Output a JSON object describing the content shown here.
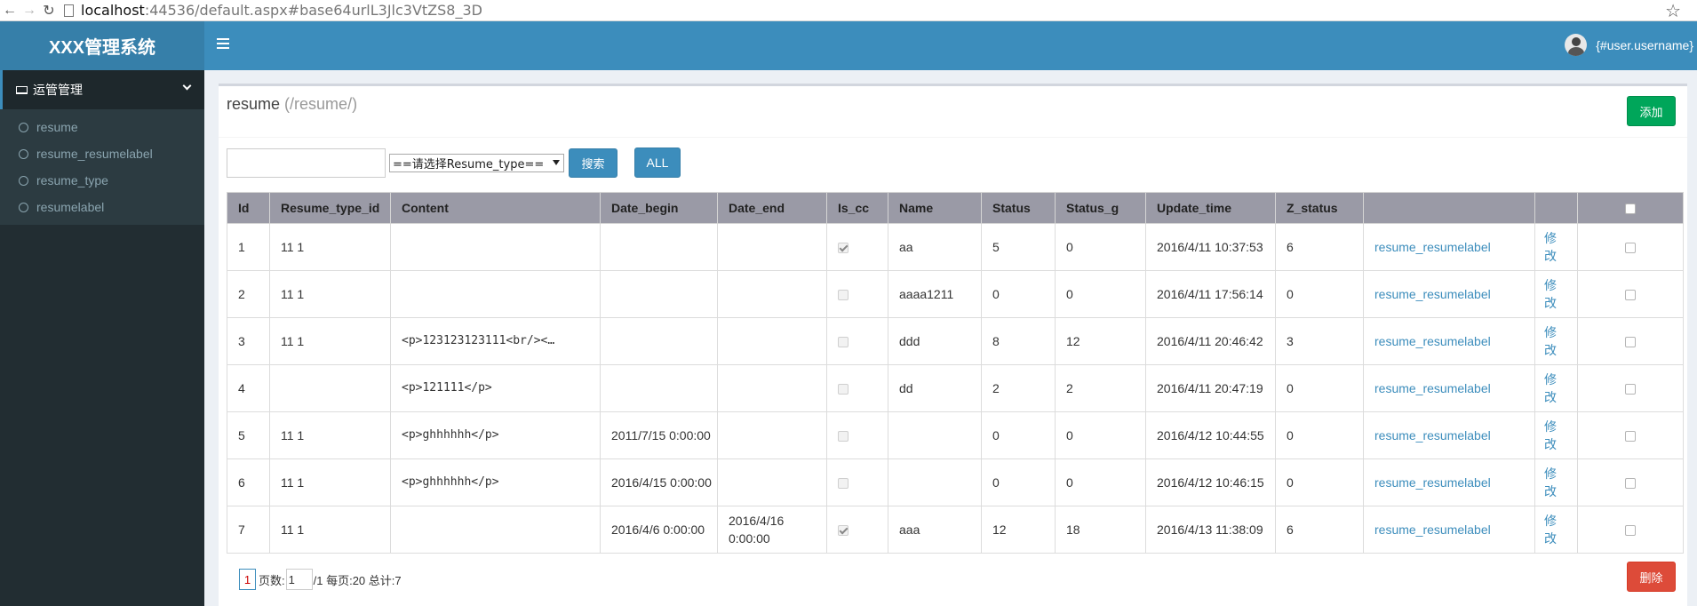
{
  "browser": {
    "url_host": "localhost",
    "url_path": ":44536/default.aspx#base64urlL3Jlc3VtZS8_3D"
  },
  "app": {
    "brand": "XXX管理系统",
    "username": "{#user.username}"
  },
  "sidebar": {
    "group_label": "运管管理",
    "items": [
      {
        "label": "resume"
      },
      {
        "label": "resume_resumelabel"
      },
      {
        "label": "resume_type"
      },
      {
        "label": "resumelabel"
      }
    ]
  },
  "page": {
    "title": "resume",
    "subtitle": "(/resume/)",
    "add_label": "添加",
    "search_placeholder": "",
    "select_label": "==请选择Resume_type==",
    "search_label": "搜索",
    "all_label": "ALL",
    "delete_label": "删除"
  },
  "table": {
    "columns": [
      "Id",
      "Resume_type_id",
      "Content",
      "Date_begin",
      "Date_end",
      "Is_cc",
      "Name",
      "Status",
      "Status_g",
      "Update_time",
      "Z_status",
      "",
      ""
    ],
    "rows": [
      {
        "id": "1",
        "type": "11 1",
        "content": "",
        "date_begin": "",
        "date_end": "",
        "is_cc": true,
        "name": "aa",
        "status": "5",
        "status_g": "0",
        "update_time": "2016/4/11 10:37:53",
        "z_status": "6",
        "link": "resume_resumelabel",
        "edit": "修改"
      },
      {
        "id": "2",
        "type": "11 1",
        "content": "",
        "date_begin": "",
        "date_end": "",
        "is_cc": false,
        "name": "aaaa1211",
        "status": "0",
        "status_g": "0",
        "update_time": "2016/4/11 17:56:14",
        "z_status": "0",
        "link": "resume_resumelabel",
        "edit": "修改"
      },
      {
        "id": "3",
        "type": "11 1",
        "content": "<p>123123123111<br/><…",
        "date_begin": "",
        "date_end": "",
        "is_cc": false,
        "name": "ddd",
        "status": "8",
        "status_g": "12",
        "update_time": "2016/4/11 20:46:42",
        "z_status": "3",
        "link": "resume_resumelabel",
        "edit": "修改"
      },
      {
        "id": "4",
        "type": "",
        "content": "<p>121111</p>",
        "date_begin": "",
        "date_end": "",
        "is_cc": false,
        "name": "dd",
        "status": "2",
        "status_g": "2",
        "update_time": "2016/4/11 20:47:19",
        "z_status": "0",
        "link": "resume_resumelabel",
        "edit": "修改"
      },
      {
        "id": "5",
        "type": "11 1",
        "content": "<p>ghhhhhh</p>",
        "date_begin": "2011/7/15 0:00:00",
        "date_end": "",
        "is_cc": false,
        "name": "",
        "status": "0",
        "status_g": "0",
        "update_time": "2016/4/12 10:44:55",
        "z_status": "0",
        "link": "resume_resumelabel",
        "edit": "修改"
      },
      {
        "id": "6",
        "type": "11 1",
        "content": "<p>ghhhhhh</p>",
        "date_begin": "2016/4/15 0:00:00",
        "date_end": "",
        "is_cc": false,
        "name": "",
        "status": "0",
        "status_g": "0",
        "update_time": "2016/4/12 10:46:15",
        "z_status": "0",
        "link": "resume_resumelabel",
        "edit": "修改"
      },
      {
        "id": "7",
        "type": "11 1",
        "content": "",
        "date_begin": "2016/4/6 0:00:00",
        "date_end": "2016/4/16 0:00:00",
        "is_cc": true,
        "name": "aaa",
        "status": "12",
        "status_g": "18",
        "update_time": "2016/4/13 11:38:09",
        "z_status": "6",
        "link": "resume_resumelabel",
        "edit": "修改"
      }
    ]
  },
  "pager": {
    "current": "1",
    "pages_label": "页数:",
    "page_value": "1",
    "info": "/1 每页:20 总计:7"
  }
}
